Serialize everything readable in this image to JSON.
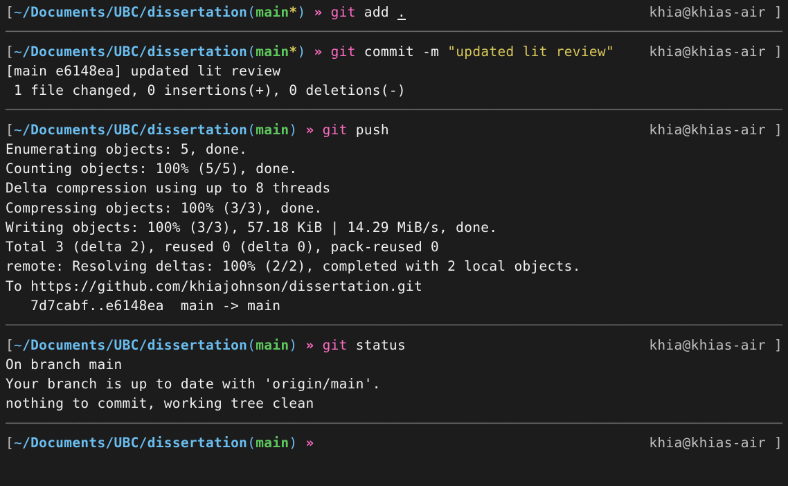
{
  "separator": "──────────────────────────────────────────────────────────────────────────────────────────────",
  "user_host": "khia@khias-air",
  "blocks": [
    {
      "type": "prompt",
      "bracket_left": "[",
      "tilde": "~",
      "path": "/Documents/UBC/dissertation",
      "paren_open": "(",
      "branch": "main",
      "dirty": "*",
      "paren_close": ")",
      "arrow": " » ",
      "git": "git",
      "cmd": " add ",
      "arg": ".",
      "underline_arg": true,
      "bracket_right": " ]"
    },
    {
      "type": "sep"
    },
    {
      "type": "prompt",
      "bracket_left": "[",
      "tilde": "~",
      "path": "/Documents/UBC/dissertation",
      "paren_open": "(",
      "branch": "main",
      "dirty": "*",
      "paren_close": ")",
      "arrow": " » ",
      "git": "git",
      "cmd": " commit -m ",
      "string": "\"updated lit review\"",
      "bracket_right": " ]"
    },
    {
      "type": "output",
      "text": "[main e6148ea] updated lit review"
    },
    {
      "type": "output",
      "text": " 1 file changed, 0 insertions(+), 0 deletions(-)"
    },
    {
      "type": "sep"
    },
    {
      "type": "prompt",
      "bracket_left": "[",
      "tilde": "~",
      "path": "/Documents/UBC/dissertation",
      "paren_open": "(",
      "branch": "main",
      "dirty": "",
      "paren_close": ")",
      "arrow": " » ",
      "git": "git",
      "cmd": " push",
      "bracket_right": " ]"
    },
    {
      "type": "output",
      "text": "Enumerating objects: 5, done."
    },
    {
      "type": "output",
      "text": "Counting objects: 100% (5/5), done."
    },
    {
      "type": "output",
      "text": "Delta compression using up to 8 threads"
    },
    {
      "type": "output",
      "text": "Compressing objects: 100% (3/3), done."
    },
    {
      "type": "output",
      "text": "Writing objects: 100% (3/3), 57.18 KiB | 14.29 MiB/s, done."
    },
    {
      "type": "output",
      "text": "Total 3 (delta 2), reused 0 (delta 0), pack-reused 0"
    },
    {
      "type": "output",
      "text": "remote: Resolving deltas: 100% (2/2), completed with 2 local objects."
    },
    {
      "type": "output",
      "text": "To https://github.com/khiajohnson/dissertation.git"
    },
    {
      "type": "output",
      "text": "   7d7cabf..e6148ea  main -> main"
    },
    {
      "type": "sep"
    },
    {
      "type": "prompt",
      "bracket_left": "[",
      "tilde": "~",
      "path": "/Documents/UBC/dissertation",
      "paren_open": "(",
      "branch": "main",
      "dirty": "",
      "paren_close": ")",
      "arrow": " » ",
      "git": "git",
      "cmd": " status",
      "bracket_right": " ]"
    },
    {
      "type": "output",
      "text": "On branch main"
    },
    {
      "type": "output",
      "text": "Your branch is up to date with 'origin/main'."
    },
    {
      "type": "output",
      "text": ""
    },
    {
      "type": "output",
      "text": "nothing to commit, working tree clean"
    },
    {
      "type": "sep"
    },
    {
      "type": "prompt",
      "bracket_left": "[",
      "tilde": "~",
      "path": "/Documents/UBC/dissertation",
      "paren_open": "(",
      "branch": "main",
      "dirty": "",
      "paren_close": ")",
      "arrow": " » ",
      "git": "",
      "cmd": "",
      "bracket_right": " ]"
    }
  ]
}
